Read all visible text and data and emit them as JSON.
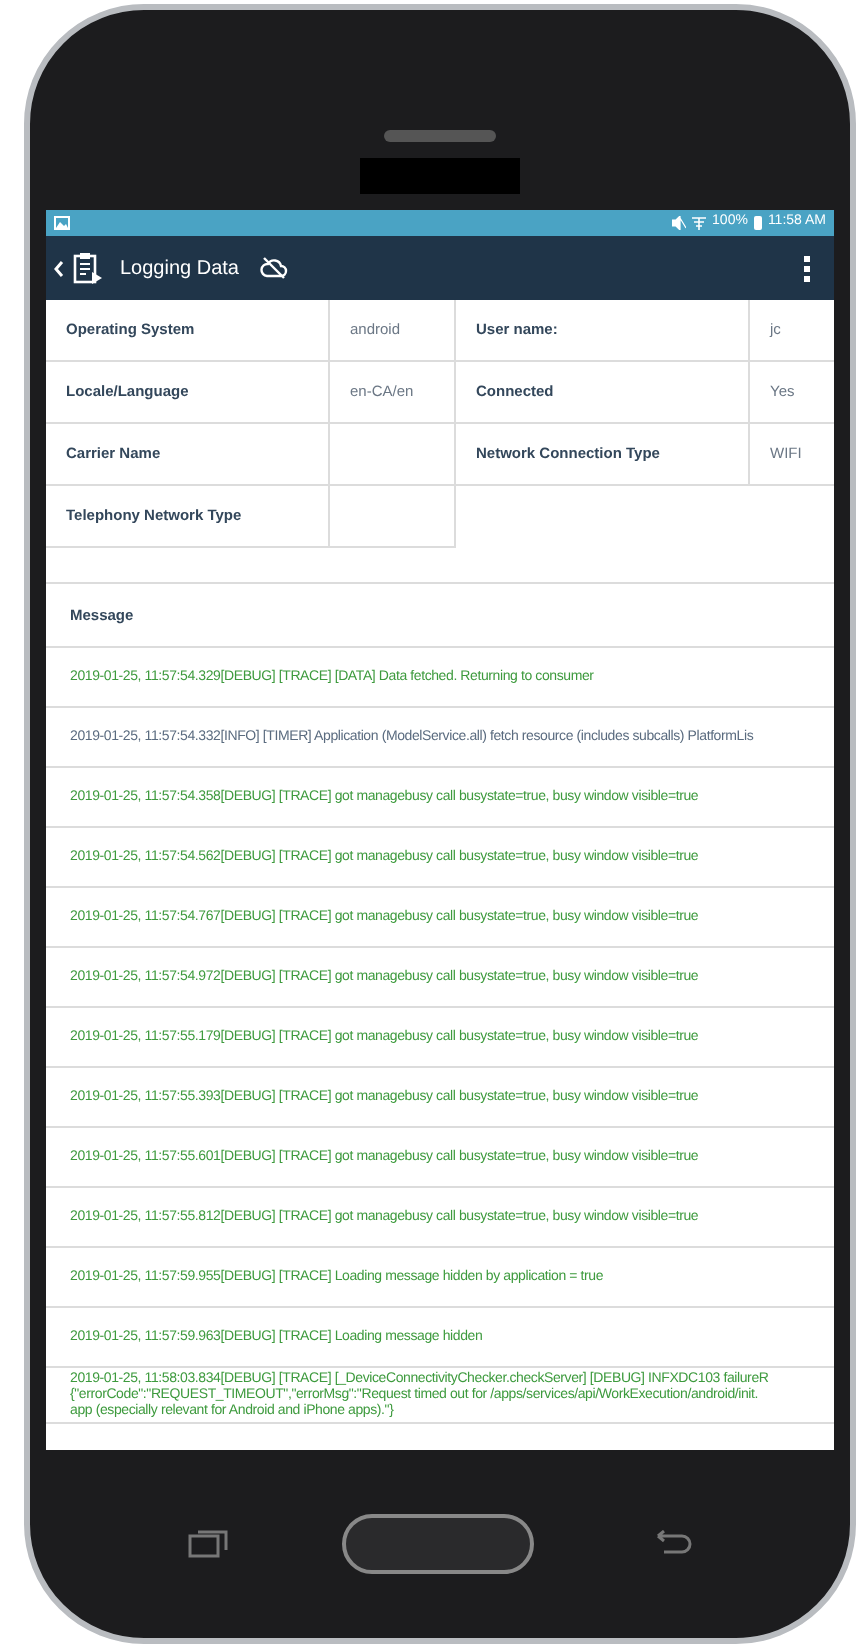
{
  "status_bar": {
    "battery": "100%",
    "time": "11:58 AM"
  },
  "header": {
    "title": "Logging Data"
  },
  "device_info": [
    {
      "label": "Operating System",
      "value": "android",
      "label_2": "User name:",
      "value_2": "jc"
    },
    {
      "label": "Locale/Language",
      "value": "en-CA/en",
      "label_2": "Connected",
      "value_2": "Yes"
    },
    {
      "label": "Carrier Name",
      "label_2": "Network Connection Type",
      "value_2": "WIFI"
    },
    {
      "label": "Telephony Network Type"
    }
  ],
  "messages": {
    "heading": "Message",
    "rows": [
      {
        "kind": "debug",
        "lines": [
          "2019-01-25, 11:57:54.329[DEBUG] [TRACE] [DATA] Data fetched. Returning to consumer"
        ]
      },
      {
        "kind": "info",
        "lines": [
          "2019-01-25, 11:57:54.332[INFO] [TIMER] Application (ModelService.all) fetch resource (includes subcalls) PlatformLis"
        ]
      },
      {
        "kind": "debug",
        "lines": [
          "2019-01-25, 11:57:54.358[DEBUG] [TRACE] got managebusy call busystate=true, busy window visible=true"
        ]
      },
      {
        "kind": "debug",
        "lines": [
          "2019-01-25, 11:57:54.562[DEBUG] [TRACE] got managebusy call busystate=true, busy window visible=true"
        ]
      },
      {
        "kind": "debug",
        "lines": [
          "2019-01-25, 11:57:54.767[DEBUG] [TRACE] got managebusy call busystate=true, busy window visible=true"
        ]
      },
      {
        "kind": "debug",
        "lines": [
          "2019-01-25, 11:57:54.972[DEBUG] [TRACE] got managebusy call busystate=true, busy window visible=true"
        ]
      },
      {
        "kind": "debug",
        "lines": [
          "2019-01-25, 11:57:55.179[DEBUG] [TRACE] got managebusy call busystate=true, busy window visible=true"
        ]
      },
      {
        "kind": "debug",
        "lines": [
          "2019-01-25, 11:57:55.393[DEBUG] [TRACE] got managebusy call busystate=true, busy window visible=true"
        ]
      },
      {
        "kind": "debug",
        "lines": [
          "2019-01-25, 11:57:55.601[DEBUG] [TRACE] got managebusy call busystate=true, busy window visible=true"
        ]
      },
      {
        "kind": "debug",
        "lines": [
          "2019-01-25, 11:57:55.812[DEBUG] [TRACE] got managebusy call busystate=true, busy window visible=true"
        ]
      },
      {
        "kind": "debug",
        "lines": [
          "2019-01-25, 11:57:59.955[DEBUG] [TRACE] Loading message hidden by application = true"
        ]
      },
      {
        "kind": "debug",
        "lines": [
          "2019-01-25, 11:57:59.963[DEBUG] [TRACE] Loading message hidden"
        ]
      },
      {
        "kind": "debug",
        "lines": [
          "2019-01-25, 11:58:03.834[DEBUG] [TRACE] [_DeviceConnectivityChecker.checkServer] [DEBUG] INFXDC103 failureR",
          "{\"errorCode\":\"REQUEST_TIMEOUT\",\"errorMsg\":\"Request timed out for /apps/services/api/WorkExecution/android/init.",
          "app (especially relevant for Android and iPhone apps).\"}"
        ]
      }
    ]
  }
}
